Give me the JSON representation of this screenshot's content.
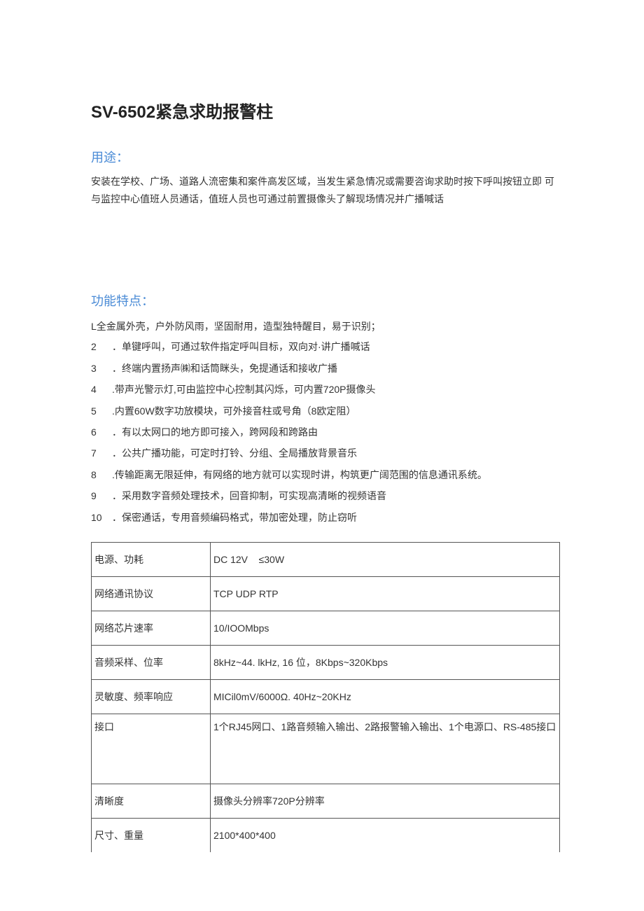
{
  "title": "SV-6502紧急求助报警柱",
  "usage": {
    "heading": "用途：",
    "text": "安装在学校、广场、道路人流密集和案件高发区域，当发生紧急情况或需要咨询求助时按下呼叫按钮立即 可与监控中心值班人员通话，值班人员也可通过前置摄像头了解现场情况并广播喊话"
  },
  "features": {
    "heading": "功能特点：",
    "first_item": "L全金属外壳，户外防风雨，坚固耐用，造型独特醒目，易于识别；",
    "items": [
      {
        "num": "2",
        "text": "．单键呼叫，可通过软件指定呼叫目标，双向对·讲广播喊话"
      },
      {
        "num": "3",
        "text": "．终端内置扬声㈱和话筒眯头，免提通话和接收广播"
      },
      {
        "num": "4",
        "text": ".带声光警示灯,可由监控中心控制其闪烁，可内置720P摄像头"
      },
      {
        "num": "5",
        "text": ".内置60W数字功放模块，可外接音柱或号角（8欧定阻）"
      },
      {
        "num": "6",
        "text": "．有以太网口的地方即可接入，跨网段和跨路由"
      },
      {
        "num": "7",
        "text": "．公共广播功能，可定时打铃、分组、全局播放背景音乐"
      },
      {
        "num": "8",
        "text": ".传输距离无限延伸，有网络的地方就可以实现时讲，构筑更广阔范围的信息通讯系统。"
      },
      {
        "num": "9",
        "text": "．采用数字音频处理技术，回音抑制，可实现高清晰的视频语音"
      },
      {
        "num": "10",
        "text": "．保密通话，专用音频编码格式，带加密处理，防止窃听"
      }
    ]
  },
  "specs": [
    {
      "label": "电源、功耗",
      "value": "DC 12V    ≤30W"
    },
    {
      "label": "网络通讯协议",
      "value": "TCP UDP RTP"
    },
    {
      "label": "网络芯片速率",
      "value": "10/IOOMbps"
    },
    {
      "label": "音频采样、位率",
      "value": "8kHz~44. lkHz, 16 位，8Kbps~320Kbps"
    },
    {
      "label": "灵敏度、频率响应",
      "value": "MICil0mV/6000Ω. 40Hz~20KHz"
    },
    {
      "label": "接口",
      "value": "1个RJ45网口、1路音频输入输出、2路报警输入输出、1个电源口、RS-485接口",
      "tall": true
    },
    {
      "label": "清晰度",
      "value": "摄像头分辨率720P分辨率"
    },
    {
      "label": "尺寸、重量",
      "value": "2100*400*400"
    }
  ]
}
